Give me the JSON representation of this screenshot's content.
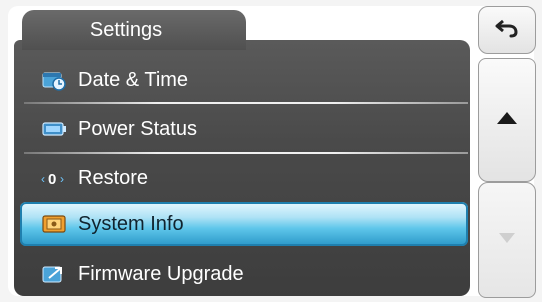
{
  "tab": {
    "title": "Settings"
  },
  "menu": {
    "items": [
      {
        "label": "Date & Time",
        "icon": "calendar-clock-icon"
      },
      {
        "label": "Power Status",
        "icon": "battery-icon"
      },
      {
        "label": "Restore",
        "icon": "restore-icon"
      },
      {
        "label": "System Info",
        "icon": "system-info-icon",
        "selected": true
      },
      {
        "label": "Firmware Upgrade",
        "icon": "firmware-upgrade-icon"
      }
    ]
  },
  "nav": {
    "back_icon": "back-arrow-icon",
    "up_icon": "triangle-up-icon",
    "down_icon": "triangle-down-icon"
  },
  "colors": {
    "panel": "#4a4a4a",
    "selection": "#5ec6ea",
    "text": "#ffffff"
  }
}
